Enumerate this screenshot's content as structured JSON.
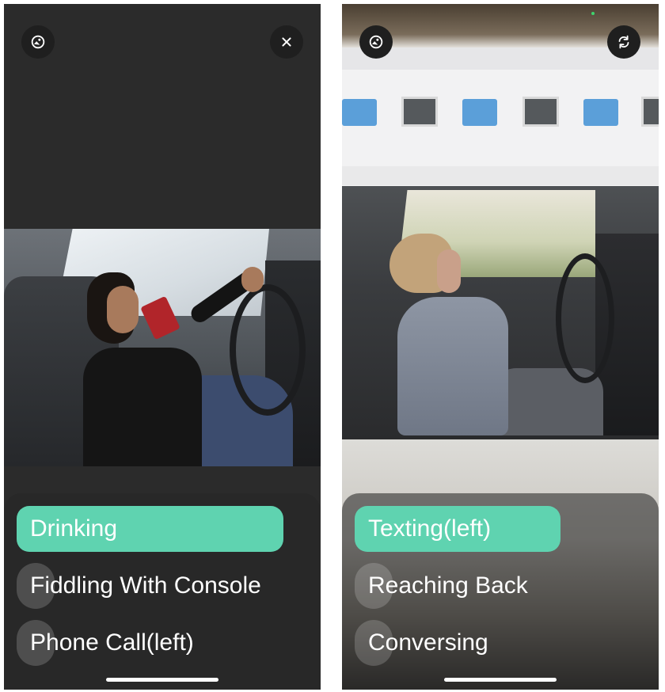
{
  "left_screen": {
    "top_left_button": {
      "icon": "gallery-icon"
    },
    "top_right_button": {
      "icon": "close-icon"
    },
    "options": [
      {
        "label": "Drinking",
        "selected": true
      },
      {
        "label": "Fiddling With Console",
        "selected": false
      },
      {
        "label": "Phone Call(left)",
        "selected": false
      }
    ]
  },
  "right_screen": {
    "top_left_button": {
      "icon": "gallery-icon"
    },
    "top_right_button": {
      "icon": "switch-camera-icon"
    },
    "options": [
      {
        "label": "Texting(left)",
        "selected": true
      },
      {
        "label": "Reaching Back",
        "selected": false
      },
      {
        "label": "Conversing",
        "selected": false
      }
    ]
  },
  "colors": {
    "selected_option": "#5fd3b0",
    "sheet": "#282828",
    "button_bg": "#1f1f1f"
  }
}
